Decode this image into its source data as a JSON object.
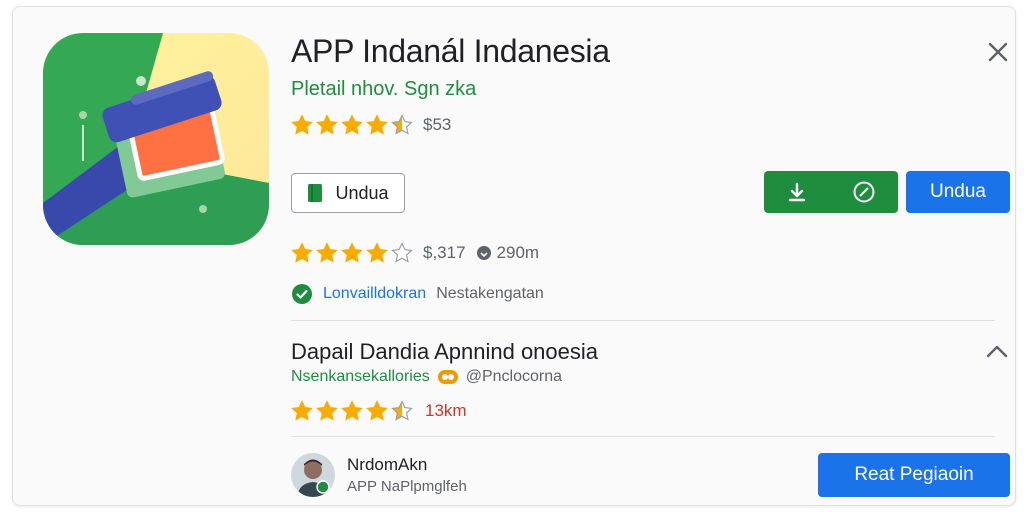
{
  "app": {
    "title": "APP Indanál Indanesia",
    "subtitle": "Pletail nhov. Sgn zka",
    "rating_text": "$53"
  },
  "buttons": {
    "outline_label": "Undua",
    "primary_label": "Undua",
    "read_label": "Reat Pegiaoin"
  },
  "stats": {
    "rating_text": "$,317",
    "downloads": "290m"
  },
  "verified": {
    "label": "Lonvailldokran",
    "sub": "Nestakengatan"
  },
  "section": {
    "title": "Dapail Dandia Apnnind onoesia",
    "developer": "Nsenkansekallories",
    "badge_text": "@Pnclocorna",
    "rating_text": "13km"
  },
  "user": {
    "name": "NrdomAkn",
    "subtitle": "APP NaPlpmglfeh"
  },
  "colors": {
    "accent_blue": "#1a73e8",
    "accent_green": "#1e8e3e",
    "star": "#f9ab00",
    "warning_red": "#d93025"
  },
  "icons": [
    "app-logo-icon",
    "close-icon",
    "book-icon",
    "download-icon",
    "check-circle-icon",
    "download-count-icon",
    "verified-check-icon",
    "chevron-up-icon",
    "badge-icon",
    "avatar"
  ],
  "ratings": {
    "first": 4.5,
    "second": 4,
    "third": 4.5
  }
}
